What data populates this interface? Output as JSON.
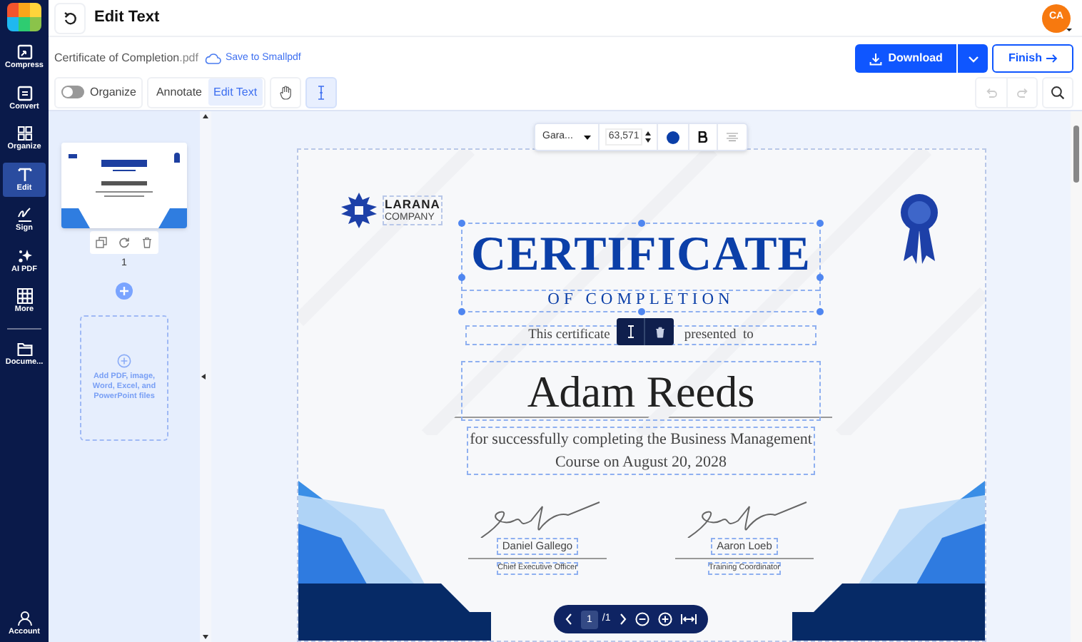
{
  "app_nav": {
    "items": [
      {
        "label": "Compress",
        "selected": false
      },
      {
        "label": "Convert",
        "selected": false
      },
      {
        "label": "Organize",
        "selected": false
      },
      {
        "label": "Edit",
        "selected": true
      },
      {
        "label": "Sign",
        "selected": false
      },
      {
        "label": "AI PDF",
        "selected": false
      },
      {
        "label": "More",
        "selected": false
      },
      {
        "label": "Docume...",
        "selected": false
      }
    ],
    "account": {
      "label": "Account"
    }
  },
  "header": {
    "title": "Edit Text",
    "avatar": "CA"
  },
  "file": {
    "name": "Certificate of Completion",
    "extension": ".pdf",
    "save_link": "Save to Smallpdf"
  },
  "actions": {
    "download": "Download",
    "finish": "Finish"
  },
  "toolbar": {
    "organize": {
      "label": "Organize",
      "on": false
    },
    "modes": [
      {
        "label": "Annotate",
        "selected": false
      },
      {
        "label": "Edit Text",
        "selected": true
      }
    ],
    "tools": [
      {
        "kind": "hand",
        "selected": false
      },
      {
        "kind": "text",
        "selected": true
      }
    ]
  },
  "thumbnails": {
    "page_number": "1",
    "add_files": "Add PDF, image, Word, Excel, and PowerPoint files"
  },
  "text_format": {
    "font": "Gara...",
    "size": "63,571",
    "color": "#0b3fa8"
  },
  "certificate": {
    "company": [
      "LARANA",
      "COMPANY"
    ],
    "title": "CERTIFICATE",
    "subtitle": "OF COMPLETION",
    "presented_to": [
      "This certificate",
      "presented  to"
    ],
    "recipient": "Adam Reeds",
    "description": [
      "for successfully completing the Business Management",
      "Course on August 20, 2028"
    ],
    "signatories": [
      {
        "name": "Daniel Gallego",
        "role": "Chief Executive Officer"
      },
      {
        "name": "Aaron Loeb",
        "role": "Training Coordinator"
      }
    ]
  },
  "pager": {
    "page": "1",
    "total": "/1"
  }
}
